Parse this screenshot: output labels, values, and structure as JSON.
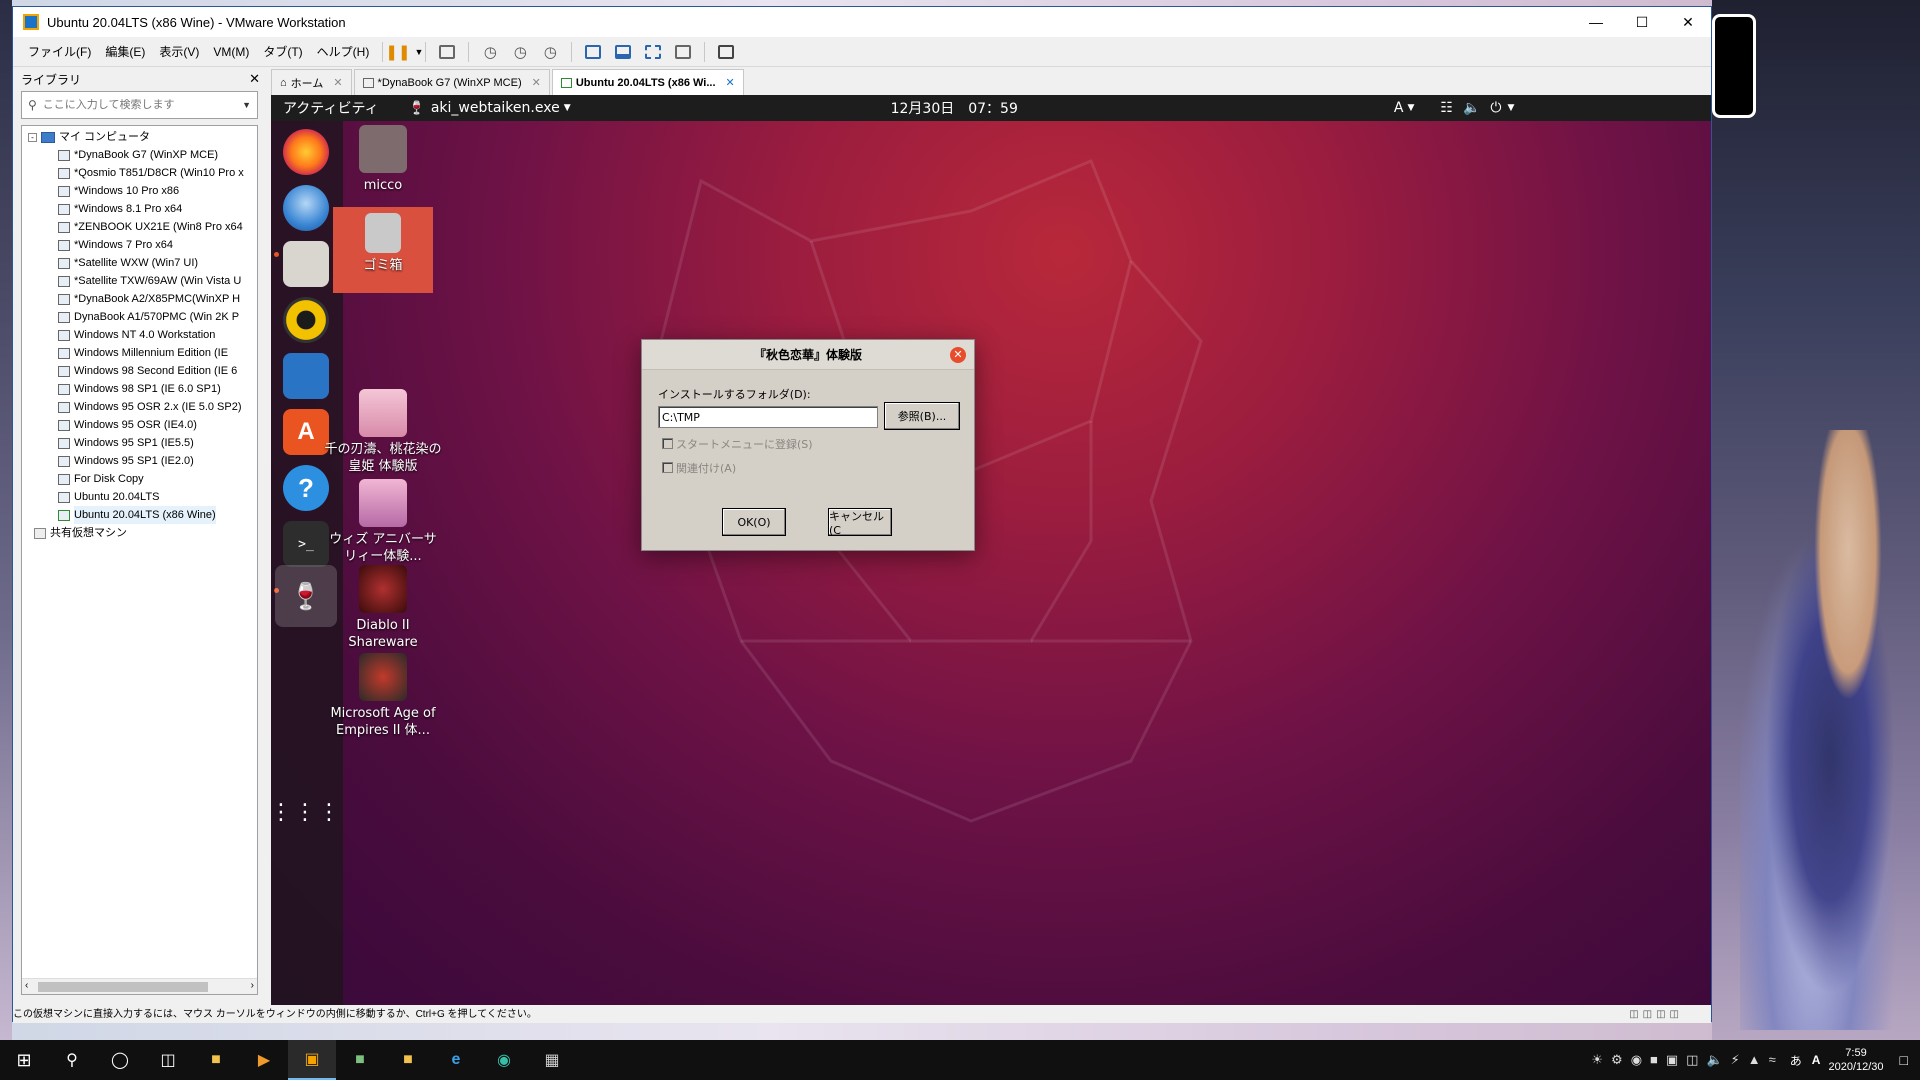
{
  "vmware": {
    "title": "Ubuntu 20.04LTS (x86 Wine) - VMware Workstation",
    "menu": [
      "ファイル(F)",
      "編集(E)",
      "表示(V)",
      "VM(M)",
      "タブ(T)",
      "ヘルプ(H)"
    ]
  },
  "library": {
    "title": "ライブラリ",
    "search_placeholder": "ここに入力して検索します",
    "root": "マイ コンピュータ",
    "items": [
      "*DynaBook G7 (WinXP MCE)",
      "*Qosmio T851/D8CR (Win10 Pro x",
      "*Windows 10 Pro x86",
      "*Windows 8.1 Pro x64",
      "*ZENBOOK UX21E (Win8 Pro x64",
      "*Windows 7 Pro x64",
      "*Satellite WXW (Win7 UI)",
      "*Satellite TXW/69AW (Win Vista U",
      "*DynaBook A2/X85PMC(WinXP H",
      "DynaBook A1/570PMC (Win 2K P",
      "Windows NT 4.0 Workstation",
      "Windows Millennium Edition (IE",
      "Windows 98 Second Edition (IE 6",
      "Windows 98 SP1 (IE 6.0 SP1)",
      "Windows 95 OSR 2.x (IE 5.0 SP2)",
      "Windows 95 OSR (IE4.0)",
      "Windows 95 SP1 (IE5.5)",
      "Windows 95 SP1 (IE2.0)",
      "For Disk Copy",
      "Ubuntu 20.04LTS",
      "Ubuntu 20.04LTS (x86 Wine)"
    ],
    "shared": "共有仮想マシン"
  },
  "tabs": [
    {
      "label": "ホーム"
    },
    {
      "label": "*DynaBook G7 (WinXP MCE)"
    },
    {
      "label": "Ubuntu 20.04LTS (x86 Wi..."
    }
  ],
  "ubuntu": {
    "activities": "アクティビティ",
    "app_menu": "aki_webtaiken.exe",
    "clock": "12月30日　07：59",
    "input_method": "A",
    "desktop_icons": [
      {
        "label": "micco"
      },
      {
        "label": "ゴミ箱"
      },
      {
        "label": "千の刃濤、桃花染の皇姫 体験版"
      },
      {
        "label": "ウィズ アニバーサリィー体験..."
      },
      {
        "label": "Diablo II Shareware"
      },
      {
        "label": "Microsoft Age of Empires II 体..."
      }
    ]
  },
  "dialog": {
    "title": "『秋色恋華』体験版",
    "folder_label": "インストールするフォルダ(D):",
    "folder_value": "C:\\TMP",
    "browse": "参照(B)...",
    "startmenu": "スタートメニューに登録(S)",
    "associate": "関連付け(A)",
    "ok": "OK(O)",
    "cancel": "キャンセル(C"
  },
  "statusbar": "この仮想マシンに直接入力するには、マウス カーソルをウィンドウの内側に移動するか、Ctrl+G を押してください。",
  "taskbar": {
    "time": "7:59",
    "date": "2020/12/30",
    "ime": "あ",
    "ime2": "A"
  },
  "colors": {
    "ubuntu_orange": "#e95420",
    "wallpaper_dark": "#38093a",
    "wallpaper_red": "#b8283a",
    "vmware_accent": "#2b579a"
  }
}
